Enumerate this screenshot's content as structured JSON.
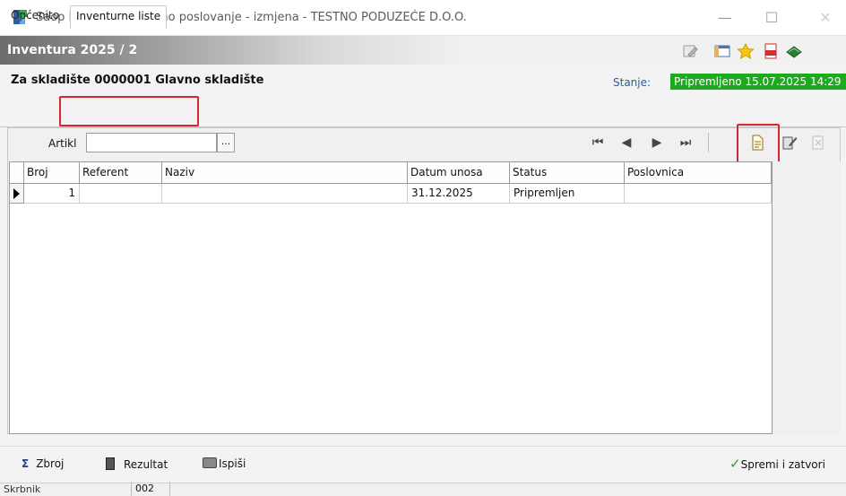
{
  "window": {
    "title": "Saop Robno materijalno poslovanje - izmjena  - TESTNO PODUZEĆE D.O.O.",
    "minimize": "—",
    "maximize": "☐",
    "close": "✕"
  },
  "form": {
    "title": "Inventura 2025 / 2",
    "warehouse": "Za skladište  0000001 Glavno skladište",
    "state_label": "Stanje:",
    "state_value": "Pripremljeno 15.07.2025 14:29"
  },
  "tabs": [
    {
      "label": "Općenito"
    },
    {
      "label": "Inventurne liste"
    }
  ],
  "filter": {
    "label": "Artikl",
    "value": "",
    "lookup": "..."
  },
  "nav": {
    "first": "⏮",
    "prev": "◀",
    "next": "▶",
    "last": "⏭"
  },
  "grid": {
    "columns": [
      "Broj",
      "Referent",
      "Naziv",
      "Datum unosa",
      "Status",
      "Poslovnica"
    ],
    "rows": [
      {
        "broj": "1",
        "referent": "",
        "naziv": "",
        "datum": "31.12.2025",
        "status": "Pripremljen",
        "poslovnica": ""
      }
    ]
  },
  "footer": {
    "sum": "Zbroj",
    "result": "Rezultat",
    "print": "Ispiši",
    "save_close": "Spremi i zatvori"
  },
  "status": {
    "label": "Skrbnik",
    "value": "002"
  },
  "colors": {
    "state_bg": "#1eaa1e",
    "highlight": "#d8262e",
    "accent_blue": "#2a5caa"
  }
}
